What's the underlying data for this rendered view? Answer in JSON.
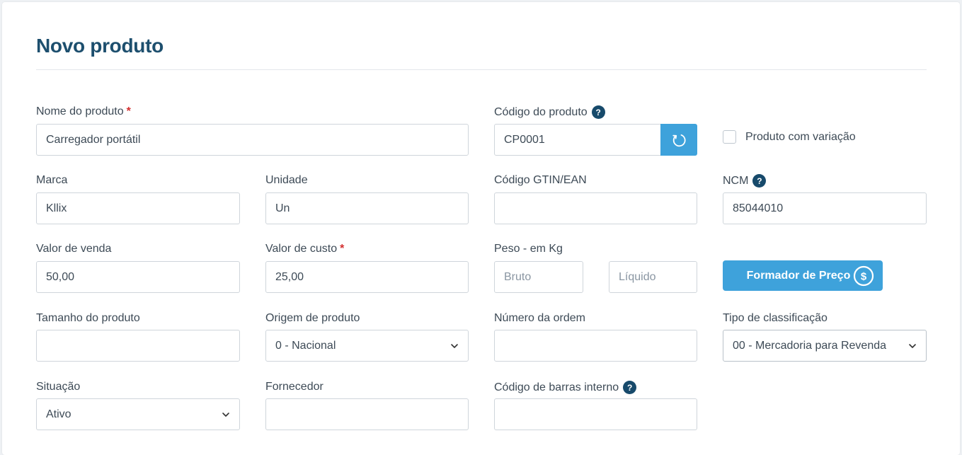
{
  "page": {
    "title": "Novo produto"
  },
  "fields": {
    "nome": {
      "label": "Nome do produto",
      "required": "*",
      "value": "Carregador portátil"
    },
    "codigo": {
      "label": "Código do produto",
      "help": "?",
      "value": "CP0001"
    },
    "variacao": {
      "label": "Produto com variação",
      "checked": false
    },
    "marca": {
      "label": "Marca",
      "value": "Kllix"
    },
    "unidade": {
      "label": "Unidade",
      "value": "Un"
    },
    "gtin": {
      "label": "Código GTIN/EAN",
      "value": ""
    },
    "ncm": {
      "label": "NCM",
      "help": "?",
      "value": "85044010"
    },
    "valor_venda": {
      "label": "Valor de venda",
      "value": "50,00"
    },
    "valor_custo": {
      "label": "Valor de custo",
      "required": "*",
      "value": "25,00"
    },
    "peso": {
      "label": "Peso - em Kg",
      "bruto_placeholder": "Bruto",
      "liquido_placeholder": "Líquido"
    },
    "tamanho": {
      "label": "Tamanho do produto",
      "value": ""
    },
    "origem": {
      "label": "Origem de produto",
      "selected": "0 - Nacional"
    },
    "numero_ordem": {
      "label": "Número da ordem",
      "value": ""
    },
    "tipo_classificacao": {
      "label": "Tipo de classificação",
      "selected": "00 - Mercadoria para Revenda"
    },
    "situacao": {
      "label": "Situação",
      "selected": "Ativo"
    },
    "fornecedor": {
      "label": "Fornecedor",
      "value": ""
    },
    "codigo_barras": {
      "label": "Código de barras interno",
      "help": "?",
      "value": ""
    }
  },
  "buttons": {
    "formador_preco": "Formador de Preço"
  },
  "icons": {
    "refresh": "refresh-icon",
    "money": "dollar-circle-icon",
    "chevron": "chevron-down-icon",
    "help": "question-circle-icon"
  },
  "colors": {
    "accent": "#3ea2db",
    "title": "#1d4f6e",
    "required": "#d32f2f",
    "help_bg": "#174a6b"
  }
}
